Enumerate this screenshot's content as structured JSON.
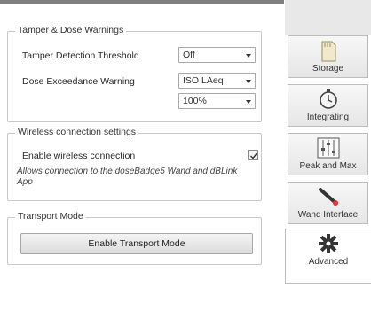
{
  "tamper": {
    "title": "Tamper & Dose Warnings",
    "threshold_label": "Tamper Detection Threshold",
    "threshold_value": "Off",
    "dose_label": "Dose Exceedance Warning",
    "dose_value": "ISO LAeq",
    "dose_percent": "100%"
  },
  "wireless": {
    "title": "Wireless connection settings",
    "enable_label": "Enable wireless connection",
    "enabled": true,
    "description": "Allows connection to the doseBadge5 Wand and dBLink App"
  },
  "transport": {
    "title": "Transport Mode",
    "button_label": "Enable Transport Mode"
  },
  "tabs": [
    {
      "label": "Storage",
      "icon": "sd-card-icon"
    },
    {
      "label": "Integrating",
      "icon": "stopwatch-icon"
    },
    {
      "label": "Peak and Max",
      "icon": "sliders-icon"
    },
    {
      "label": "Wand Interface",
      "icon": "wand-icon"
    },
    {
      "label": "Advanced",
      "icon": "gear-icon",
      "active": true
    }
  ]
}
